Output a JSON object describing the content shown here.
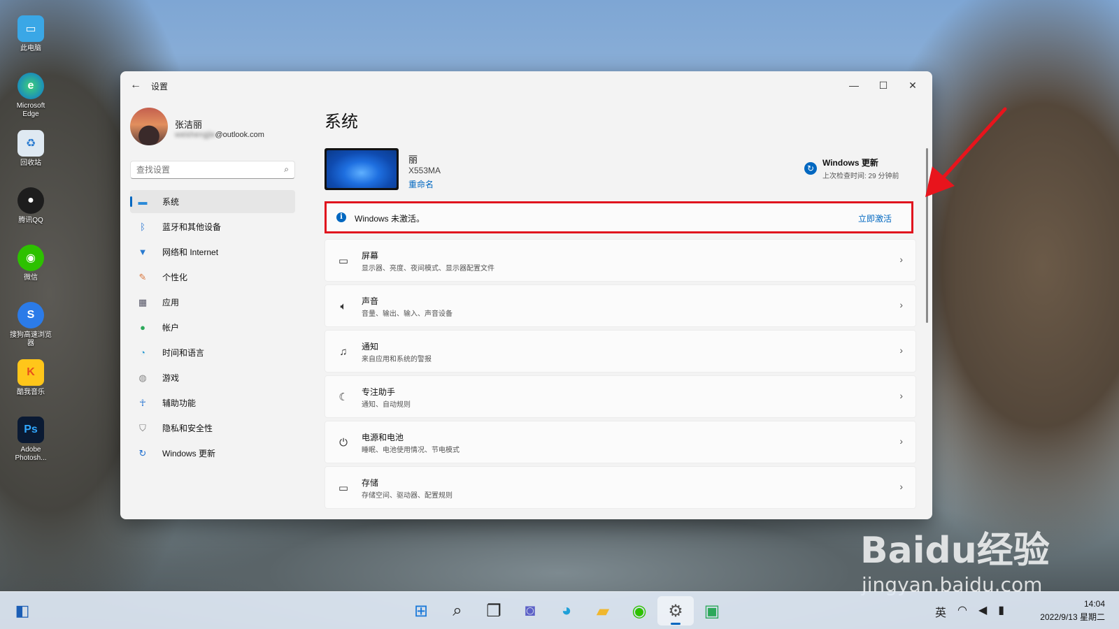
{
  "desktop": {
    "icons": [
      {
        "label": "此电脑"
      },
      {
        "label": "Microsoft Edge"
      },
      {
        "label": "回收站"
      },
      {
        "label": "腾讯QQ"
      },
      {
        "label": "微信"
      },
      {
        "label": "搜狗高速浏览器"
      },
      {
        "label": "酷我音乐"
      },
      {
        "label": "Adobe Photosh..."
      }
    ]
  },
  "window": {
    "title": "设置",
    "minimize": "—",
    "maximize": "☐",
    "close": "✕"
  },
  "profile": {
    "name": "张洁丽",
    "email_hidden": "weishengjie",
    "email_domain": "@outlook.com"
  },
  "search": {
    "placeholder": "查找设置"
  },
  "nav": {
    "items": [
      {
        "label": "系统",
        "icon": "monitor-icon"
      },
      {
        "label": "蓝牙和其他设备",
        "icon": "bluetooth-icon"
      },
      {
        "label": "网络和 Internet",
        "icon": "wifi-icon"
      },
      {
        "label": "个性化",
        "icon": "brush-icon"
      },
      {
        "label": "应用",
        "icon": "apps-icon"
      },
      {
        "label": "帐户",
        "icon": "person-icon"
      },
      {
        "label": "时间和语言",
        "icon": "globe-clock-icon"
      },
      {
        "label": "游戏",
        "icon": "gamepad-icon"
      },
      {
        "label": "辅助功能",
        "icon": "accessibility-icon"
      },
      {
        "label": "隐私和安全性",
        "icon": "shield-icon"
      },
      {
        "label": "Windows 更新",
        "icon": "update-icon"
      }
    ]
  },
  "main": {
    "title": "系统",
    "device": {
      "name": "丽",
      "model": "X553MA",
      "rename": "重命名"
    },
    "update": {
      "title": "Windows 更新",
      "last_checked": "上次检查时间: 29 分钟前"
    },
    "activation": {
      "text": "Windows 未激活。",
      "button": "立即激活"
    },
    "cards": [
      {
        "title": "屏幕",
        "subtitle": "显示器、亮度、夜间模式、显示器配置文件",
        "icon": "display-icon"
      },
      {
        "title": "声音",
        "subtitle": "音量、输出、输入、声音设备",
        "icon": "speaker-icon"
      },
      {
        "title": "通知",
        "subtitle": "来自应用和系统的警报",
        "icon": "bell-icon"
      },
      {
        "title": "专注助手",
        "subtitle": "通知、自动规则",
        "icon": "moon-icon"
      },
      {
        "title": "电源和电池",
        "subtitle": "睡眠、电池使用情况、节电模式",
        "icon": "power-icon"
      },
      {
        "title": "存储",
        "subtitle": "存储空间、驱动器、配置规则",
        "icon": "storage-icon"
      }
    ]
  },
  "watermark": {
    "brand": "Baidu经验",
    "url": "jingyan.baidu.com"
  },
  "taskbar": {
    "ime": "英",
    "time": "14:04",
    "date": "2022/9/13 星期二"
  },
  "colors": {
    "accent": "#0067c0",
    "highlight_border": "#e0141e"
  }
}
